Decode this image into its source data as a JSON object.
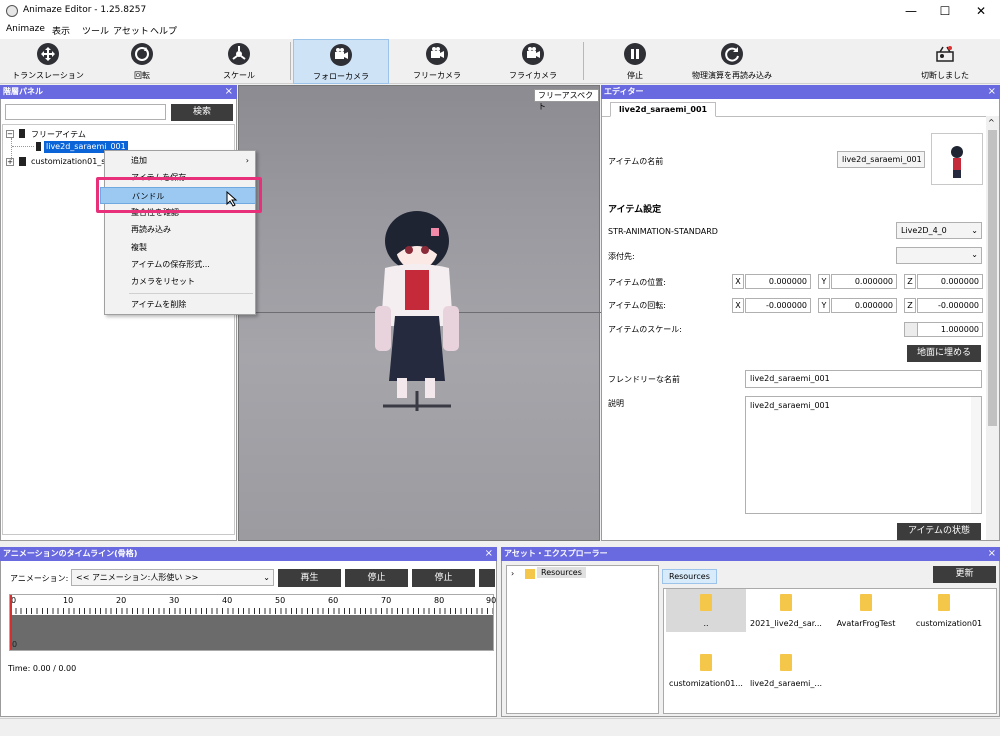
{
  "window": {
    "title": "Animaze Editor - 1.25.8257",
    "minimize": "—",
    "maximize": "☐",
    "close": "✕"
  },
  "menu": [
    "Animaze",
    "表示",
    "ツール",
    "アセット",
    "ヘルプ"
  ],
  "toolbar": {
    "items": [
      {
        "label": "トランスレーション",
        "icon": "move-icon"
      },
      {
        "label": "回転",
        "icon": "rotate-icon"
      },
      {
        "label": "スケール",
        "icon": "scale-icon"
      },
      {
        "label": "フォローカメラ",
        "icon": "camera-icon"
      },
      {
        "label": "フリーカメラ",
        "icon": "camera-icon"
      },
      {
        "label": "フライカメラ",
        "icon": "camera-icon"
      },
      {
        "label": "停止",
        "icon": "pause-icon"
      },
      {
        "label": "物理演算を再読み込み",
        "icon": "reload-icon"
      },
      {
        "label": "切断しました",
        "icon": "disconnect-icon"
      }
    ]
  },
  "hierarchy": {
    "title": "階層パネル",
    "search_button": "検索",
    "search_value": "",
    "tree": {
      "root": "フリーアイテム",
      "selected_child": "live2d_saraemi_001",
      "second_root": "customization01_s"
    }
  },
  "context_menu": {
    "items": [
      "追加",
      "アイテムを保存",
      "バンドル",
      "整合性を確認",
      "再読み込み",
      "複製",
      "アイテムの保存形式...",
      "カメラをリセット",
      "アイテムを削除"
    ],
    "submenu_arrow": "›"
  },
  "viewport": {
    "view_mode": "フリーアスペクト"
  },
  "editor": {
    "title": "エディター",
    "tab": "live2d_saraemi_001",
    "item_name_label": "アイテムの名前",
    "item_name_value": "live2d_saraemi_001",
    "settings_heading": "アイテム設定",
    "animation_label": "STR-ANIMATION-STANDARD",
    "animation_value": "Live2D_4_0",
    "attach_label": "添付先:",
    "attach_value": "",
    "position_label": "アイテムの位置:",
    "position": {
      "x": "0.000000",
      "y": "0.000000",
      "z": "0.000000"
    },
    "rotation_label": "アイテムの回転:",
    "rotation": {
      "x": "-0.000000",
      "y": "0.000000",
      "z": "-0.000000"
    },
    "scale_label": "アイテムのスケール:",
    "scale": "1.000000",
    "ground_button": "地面に埋める",
    "friendly_label": "フレンドリーな名前",
    "friendly_value": "live2d_saraemi_001",
    "description_label": "説明",
    "description_value": "live2d_saraemi_001",
    "state_button": "アイテムの状態",
    "axis": {
      "x": "X",
      "y": "Y",
      "z": "Z"
    }
  },
  "timeline": {
    "title": "アニメーションのタイムライン(骨格)",
    "animation_label": "アニメーション:",
    "animation_value": "<< アニメーション:人形使い >>",
    "play": "再生",
    "stop": "停止",
    "pause": "停止",
    "ticks": [
      "0",
      "10",
      "20",
      "30",
      "40",
      "50",
      "60",
      "70",
      "80",
      "90"
    ],
    "track_start": "0",
    "time": "Time: 0.00 / 0.00"
  },
  "assets": {
    "title": "アセット・エクスプローラー",
    "tree_root": "Resources",
    "breadcrumb": "Resources",
    "refresh": "更新",
    "folders": [
      "..",
      "2021_live2d_sar...",
      "AvatarFrogTest",
      "customization01",
      "customization01...",
      "live2d_saraemi_..."
    ]
  },
  "colors": {
    "panel_header": "#6a6ae0",
    "highlight": "#e8307a",
    "selection": "#0a64d8"
  }
}
